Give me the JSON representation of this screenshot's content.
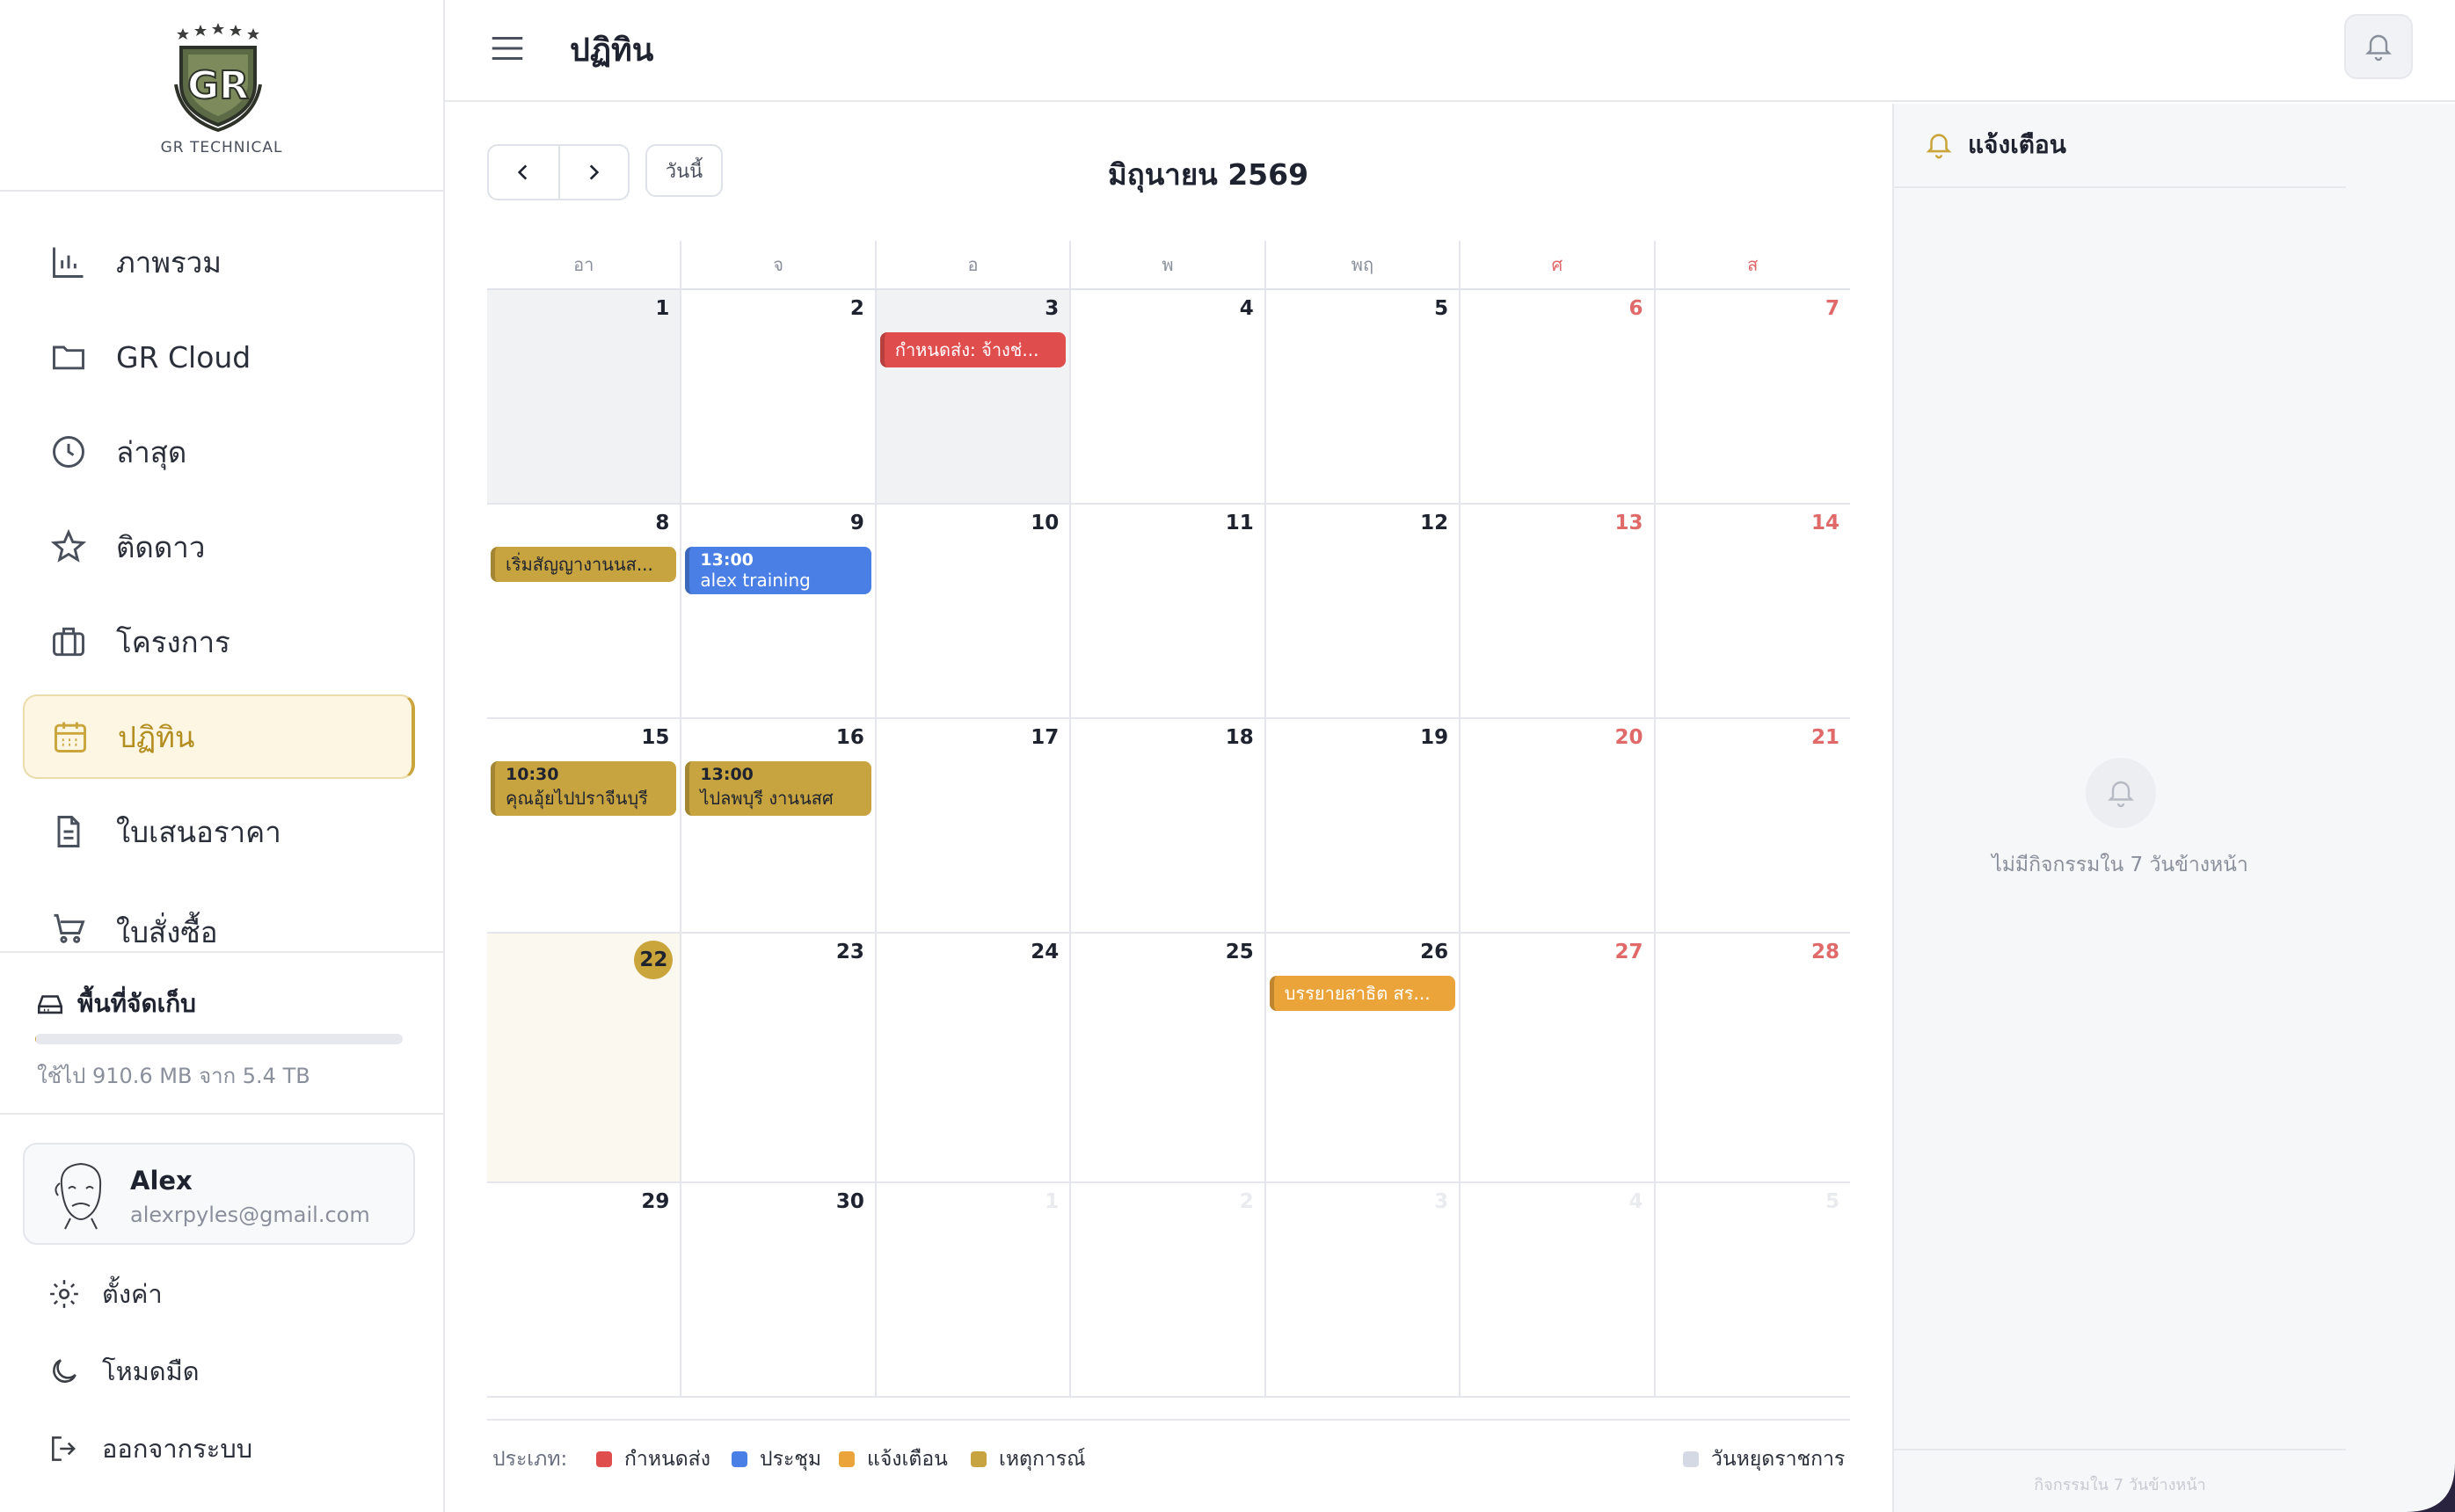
{
  "brand": {
    "name": "GR TECHNICAL",
    "logo_text": "GR"
  },
  "sidebar": {
    "items": [
      {
        "label": "ภาพรวม",
        "icon": "bar-chart-icon"
      },
      {
        "label": "GR Cloud",
        "icon": "folder-icon"
      },
      {
        "label": "ล่าสุด",
        "icon": "clock-icon"
      },
      {
        "label": "ติดดาว",
        "icon": "star-icon"
      },
      {
        "label": "โครงการ",
        "icon": "briefcase-icon"
      },
      {
        "label": "ปฏิทิน",
        "icon": "calendar-icon",
        "active": true
      },
      {
        "label": "ใบเสนอราคา",
        "icon": "document-icon"
      },
      {
        "label": "ใบสั่งซื้อ",
        "icon": "cart-icon"
      }
    ],
    "storage": {
      "title": "พื้นที่จัดเก็บ",
      "usage_text": "ใช้ไป 910.6 MB จาก 5.4 TB",
      "used_fraction": 0.0002
    },
    "user": {
      "name": "Alex",
      "email": "alexrpyles@gmail.com"
    },
    "footer": [
      {
        "label": "ตั้งค่า",
        "icon": "gear-icon"
      },
      {
        "label": "โหมดมืด",
        "icon": "moon-icon"
      },
      {
        "label": "ออกจากระบบ",
        "icon": "logout-icon"
      }
    ]
  },
  "topbar": {
    "title": "ปฏิทิน"
  },
  "calendar": {
    "today_label": "วันนี้",
    "month_title": "มิถุนายน 2569",
    "weekdays": [
      "อา",
      "จ",
      "อ",
      "พ",
      "พฤ",
      "ศ",
      "ส"
    ],
    "weeks": [
      [
        {
          "day": "1",
          "shaded": true
        },
        {
          "day": "2"
        },
        {
          "day": "3",
          "shaded": true,
          "events": [
            {
              "text": "กำหนดส่ง: จ้างช่...",
              "color": "red"
            }
          ]
        },
        {
          "day": "4"
        },
        {
          "day": "5"
        },
        {
          "day": "6"
        },
        {
          "day": "7"
        }
      ],
      [
        {
          "day": "8",
          "events": [
            {
              "text": "เริ่มสัญญางานนส...",
              "color": "gold"
            }
          ]
        },
        {
          "day": "9",
          "events": [
            {
              "time": "13:00",
              "text": "alex training",
              "color": "blue"
            }
          ]
        },
        {
          "day": "10"
        },
        {
          "day": "11"
        },
        {
          "day": "12"
        },
        {
          "day": "13"
        },
        {
          "day": "14"
        }
      ],
      [
        {
          "day": "15",
          "events": [
            {
              "time": "10:30",
              "text": "คุณอุ้ยไปปราจีนบุรี",
              "color": "gold"
            }
          ]
        },
        {
          "day": "16",
          "events": [
            {
              "time": "13:00",
              "text": "ไปลพบุรี งานนสศ",
              "color": "gold"
            }
          ]
        },
        {
          "day": "17"
        },
        {
          "day": "18"
        },
        {
          "day": "19"
        },
        {
          "day": "20"
        },
        {
          "day": "21"
        }
      ],
      [
        {
          "day": "22",
          "today": true
        },
        {
          "day": "23"
        },
        {
          "day": "24"
        },
        {
          "day": "25"
        },
        {
          "day": "26",
          "events": [
            {
              "text": "บรรยายสาธิต สร...",
              "color": "orange"
            }
          ]
        },
        {
          "day": "27"
        },
        {
          "day": "28"
        }
      ],
      [
        {
          "day": "29"
        },
        {
          "day": "30"
        },
        {
          "day": "1",
          "other": true
        },
        {
          "day": "2",
          "other": true
        },
        {
          "day": "3",
          "other": true
        },
        {
          "day": "4",
          "other": true
        },
        {
          "day": "5",
          "other": true
        }
      ]
    ],
    "legend": {
      "label": "ประเภท:",
      "items": [
        {
          "label": "กำหนดส่ง",
          "color": "#e04d4d"
        },
        {
          "label": "ประชุม",
          "color": "#4a7fe6"
        },
        {
          "label": "แจ้งเตือน",
          "color": "#eba43a"
        },
        {
          "label": "เหตุการณ์",
          "color": "#c7a43f"
        }
      ],
      "holiday": {
        "label": "วันหยุดราชการ",
        "color": "#d5d9e3"
      }
    }
  },
  "notifications": {
    "title": "แจ้งเตือน",
    "empty_text": "ไม่มีกิจกรรมใน 7 วันข้างหน้า",
    "footer_text": "กิจกรรมใน 7 วันข้างหน้า"
  },
  "colors": {
    "accent": "#c9a53c",
    "weekend": "#e06a6a"
  }
}
